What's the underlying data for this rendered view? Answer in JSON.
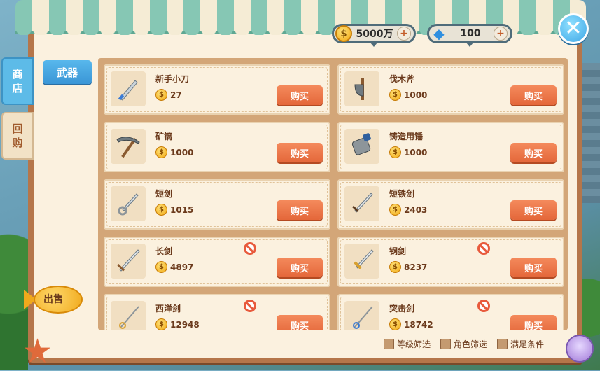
{
  "currency": {
    "gold": {
      "value": "5000万",
      "icon": "coin"
    },
    "gem": {
      "value": "100",
      "icon": "diamond"
    },
    "plus_symbol": "+"
  },
  "close_symbol": "✕",
  "side_tabs": [
    {
      "label": "商\n店",
      "active": true
    },
    {
      "label": "回\n购",
      "active": false
    }
  ],
  "category": {
    "label": "武器"
  },
  "coin_symbol": "$",
  "items": [
    {
      "name": "新手小刀",
      "price": "27",
      "buy_label": "购买",
      "locked": false,
      "icon": "knife"
    },
    {
      "name": "伐木斧",
      "price": "1000",
      "buy_label": "购买",
      "locked": false,
      "icon": "axe"
    },
    {
      "name": "矿镐",
      "price": "1000",
      "buy_label": "购买",
      "locked": false,
      "icon": "pickaxe"
    },
    {
      "name": "铸造用锤",
      "price": "1000",
      "buy_label": "购买",
      "locked": false,
      "icon": "hammer"
    },
    {
      "name": "短剑",
      "price": "1015",
      "buy_label": "购买",
      "locked": false,
      "icon": "short-sword"
    },
    {
      "name": "短铁剑",
      "price": "2403",
      "buy_label": "购买",
      "locked": false,
      "icon": "iron-short-sword"
    },
    {
      "name": "长剑",
      "price": "4897",
      "buy_label": "购买",
      "locked": true,
      "icon": "long-sword"
    },
    {
      "name": "钢剑",
      "price": "8237",
      "buy_label": "购买",
      "locked": true,
      "icon": "steel-sword"
    },
    {
      "name": "西洋剑",
      "price": "12948",
      "buy_label": "购买",
      "locked": true,
      "icon": "rapier"
    },
    {
      "name": "突击剑",
      "price": "18742",
      "buy_label": "购买",
      "locked": true,
      "icon": "thrust-sword"
    }
  ],
  "filters": [
    {
      "label": "等级筛选"
    },
    {
      "label": "角色筛选"
    },
    {
      "label": "满足条件"
    }
  ],
  "sell": {
    "label": "出售"
  }
}
